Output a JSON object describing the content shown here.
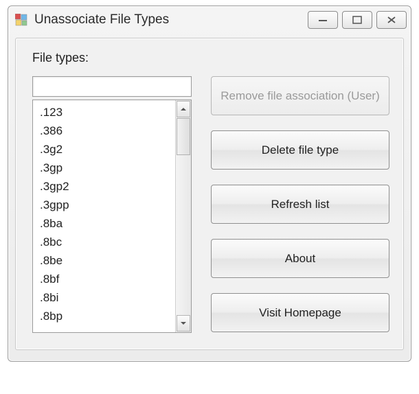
{
  "window": {
    "title": "Unassociate File Types"
  },
  "label": "File types:",
  "filter": {
    "value": "",
    "placeholder": ""
  },
  "items": [
    ".123",
    ".386",
    ".3g2",
    ".3gp",
    ".3gp2",
    ".3gpp",
    ".8ba",
    ".8bc",
    ".8be",
    ".8bf",
    ".8bi",
    ".8bp"
  ],
  "buttons": {
    "remove": "Remove file association (User)",
    "delete": "Delete file type",
    "refresh": "Refresh list",
    "about": "About",
    "homepage": "Visit Homepage"
  }
}
